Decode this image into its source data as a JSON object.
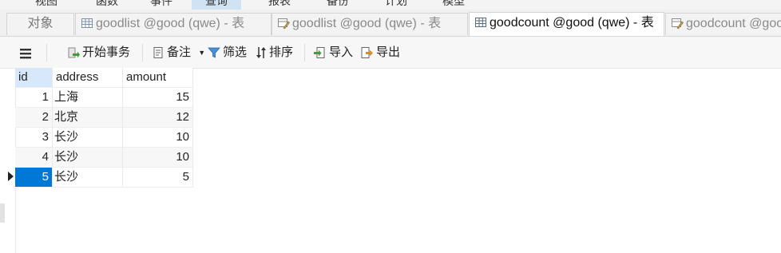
{
  "menu": [
    "视图",
    "函数",
    "事件",
    "查询",
    "报表",
    "备份",
    "计划",
    "模型"
  ],
  "menu_active_index": 3,
  "tabs": [
    {
      "label": "对象",
      "icon": "none",
      "active": false
    },
    {
      "label": "goodlist @good (qwe) - 表",
      "icon": "table-icon",
      "active": false
    },
    {
      "label": "goodlist @good (qwe) - 表",
      "icon": "table-design-icon",
      "active": false
    },
    {
      "label": "goodcount @good (qwe) - 表",
      "icon": "table-icon",
      "active": true
    },
    {
      "label": "goodcount @good",
      "icon": "table-design-icon",
      "active": false
    }
  ],
  "toolbar": {
    "begin_transaction": "开始事务",
    "memo": "备注",
    "filter": "筛选",
    "sort": "排序",
    "import": "导入",
    "export": "导出"
  },
  "grid": {
    "columns": [
      "id",
      "address",
      "amount"
    ],
    "rows": [
      {
        "id": "1",
        "address": "上海",
        "amount": "15"
      },
      {
        "id": "2",
        "address": "北京",
        "amount": "12"
      },
      {
        "id": "3",
        "address": "长沙",
        "amount": "10"
      },
      {
        "id": "4",
        "address": "长沙",
        "amount": "10"
      },
      {
        "id": "5",
        "address": "长沙",
        "amount": "5"
      }
    ],
    "selected_row": 4
  },
  "colors": {
    "accent": "#0078d7",
    "header_selected": "#d6e8fa"
  }
}
